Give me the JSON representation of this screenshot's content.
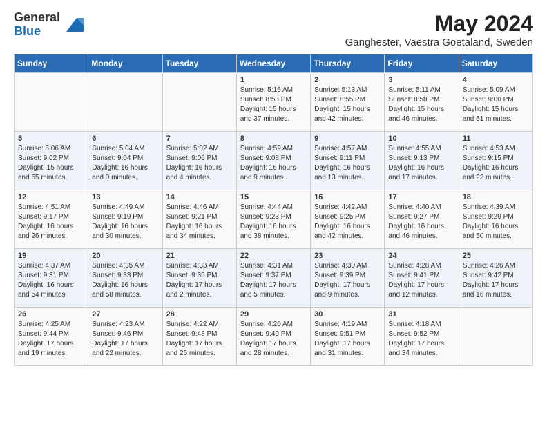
{
  "logo": {
    "general": "General",
    "blue": "Blue"
  },
  "title": {
    "month_year": "May 2024",
    "location": "Ganghester, Vaestra Goetaland, Sweden"
  },
  "headers": [
    "Sunday",
    "Monday",
    "Tuesday",
    "Wednesday",
    "Thursday",
    "Friday",
    "Saturday"
  ],
  "weeks": [
    [
      {
        "day": "",
        "info": ""
      },
      {
        "day": "",
        "info": ""
      },
      {
        "day": "",
        "info": ""
      },
      {
        "day": "1",
        "info": "Sunrise: 5:16 AM\nSunset: 8:53 PM\nDaylight: 15 hours\nand 37 minutes."
      },
      {
        "day": "2",
        "info": "Sunrise: 5:13 AM\nSunset: 8:55 PM\nDaylight: 15 hours\nand 42 minutes."
      },
      {
        "day": "3",
        "info": "Sunrise: 5:11 AM\nSunset: 8:58 PM\nDaylight: 15 hours\nand 46 minutes."
      },
      {
        "day": "4",
        "info": "Sunrise: 5:09 AM\nSunset: 9:00 PM\nDaylight: 15 hours\nand 51 minutes."
      }
    ],
    [
      {
        "day": "5",
        "info": "Sunrise: 5:06 AM\nSunset: 9:02 PM\nDaylight: 15 hours\nand 55 minutes."
      },
      {
        "day": "6",
        "info": "Sunrise: 5:04 AM\nSunset: 9:04 PM\nDaylight: 16 hours\nand 0 minutes."
      },
      {
        "day": "7",
        "info": "Sunrise: 5:02 AM\nSunset: 9:06 PM\nDaylight: 16 hours\nand 4 minutes."
      },
      {
        "day": "8",
        "info": "Sunrise: 4:59 AM\nSunset: 9:08 PM\nDaylight: 16 hours\nand 9 minutes."
      },
      {
        "day": "9",
        "info": "Sunrise: 4:57 AM\nSunset: 9:11 PM\nDaylight: 16 hours\nand 13 minutes."
      },
      {
        "day": "10",
        "info": "Sunrise: 4:55 AM\nSunset: 9:13 PM\nDaylight: 16 hours\nand 17 minutes."
      },
      {
        "day": "11",
        "info": "Sunrise: 4:53 AM\nSunset: 9:15 PM\nDaylight: 16 hours\nand 22 minutes."
      }
    ],
    [
      {
        "day": "12",
        "info": "Sunrise: 4:51 AM\nSunset: 9:17 PM\nDaylight: 16 hours\nand 26 minutes."
      },
      {
        "day": "13",
        "info": "Sunrise: 4:49 AM\nSunset: 9:19 PM\nDaylight: 16 hours\nand 30 minutes."
      },
      {
        "day": "14",
        "info": "Sunrise: 4:46 AM\nSunset: 9:21 PM\nDaylight: 16 hours\nand 34 minutes."
      },
      {
        "day": "15",
        "info": "Sunrise: 4:44 AM\nSunset: 9:23 PM\nDaylight: 16 hours\nand 38 minutes."
      },
      {
        "day": "16",
        "info": "Sunrise: 4:42 AM\nSunset: 9:25 PM\nDaylight: 16 hours\nand 42 minutes."
      },
      {
        "day": "17",
        "info": "Sunrise: 4:40 AM\nSunset: 9:27 PM\nDaylight: 16 hours\nand 46 minutes."
      },
      {
        "day": "18",
        "info": "Sunrise: 4:39 AM\nSunset: 9:29 PM\nDaylight: 16 hours\nand 50 minutes."
      }
    ],
    [
      {
        "day": "19",
        "info": "Sunrise: 4:37 AM\nSunset: 9:31 PM\nDaylight: 16 hours\nand 54 minutes."
      },
      {
        "day": "20",
        "info": "Sunrise: 4:35 AM\nSunset: 9:33 PM\nDaylight: 16 hours\nand 58 minutes."
      },
      {
        "day": "21",
        "info": "Sunrise: 4:33 AM\nSunset: 9:35 PM\nDaylight: 17 hours\nand 2 minutes."
      },
      {
        "day": "22",
        "info": "Sunrise: 4:31 AM\nSunset: 9:37 PM\nDaylight: 17 hours\nand 5 minutes."
      },
      {
        "day": "23",
        "info": "Sunrise: 4:30 AM\nSunset: 9:39 PM\nDaylight: 17 hours\nand 9 minutes."
      },
      {
        "day": "24",
        "info": "Sunrise: 4:28 AM\nSunset: 9:41 PM\nDaylight: 17 hours\nand 12 minutes."
      },
      {
        "day": "25",
        "info": "Sunrise: 4:26 AM\nSunset: 9:42 PM\nDaylight: 17 hours\nand 16 minutes."
      }
    ],
    [
      {
        "day": "26",
        "info": "Sunrise: 4:25 AM\nSunset: 9:44 PM\nDaylight: 17 hours\nand 19 minutes."
      },
      {
        "day": "27",
        "info": "Sunrise: 4:23 AM\nSunset: 9:46 PM\nDaylight: 17 hours\nand 22 minutes."
      },
      {
        "day": "28",
        "info": "Sunrise: 4:22 AM\nSunset: 9:48 PM\nDaylight: 17 hours\nand 25 minutes."
      },
      {
        "day": "29",
        "info": "Sunrise: 4:20 AM\nSunset: 9:49 PM\nDaylight: 17 hours\nand 28 minutes."
      },
      {
        "day": "30",
        "info": "Sunrise: 4:19 AM\nSunset: 9:51 PM\nDaylight: 17 hours\nand 31 minutes."
      },
      {
        "day": "31",
        "info": "Sunrise: 4:18 AM\nSunset: 9:52 PM\nDaylight: 17 hours\nand 34 minutes."
      },
      {
        "day": "",
        "info": ""
      }
    ]
  ]
}
